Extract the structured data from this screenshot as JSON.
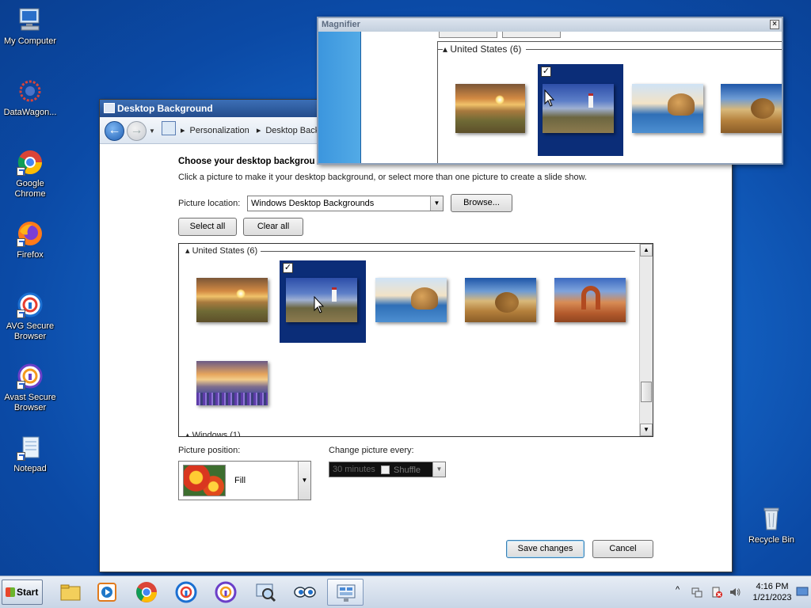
{
  "desktop": {
    "icons": [
      {
        "label": "My Computer"
      },
      {
        "label": "DataWagon..."
      },
      {
        "label": "Google Chrome"
      },
      {
        "label": "Firefox"
      },
      {
        "label": "AVG Secure Browser"
      },
      {
        "label": "Avast Secure Browser"
      },
      {
        "label": "Notepad"
      },
      {
        "label": "Recycle Bin"
      }
    ]
  },
  "window": {
    "title": "Desktop Background",
    "breadcrumb": [
      "Personalization",
      "Desktop Backgro"
    ]
  },
  "content": {
    "heading": "Choose your desktop backgrou",
    "subheading": "Click a picture to make it your desktop background, or select more than one picture to create a slide show.",
    "picture_location_label": "Picture location:",
    "picture_location_value": "Windows Desktop Backgrounds",
    "browse_label": "Browse...",
    "select_all_label": "Select all",
    "clear_all_label": "Clear all",
    "group_united_states": "United States (6)",
    "group_windows": "Windows (1)",
    "thumbnails": [
      {
        "name": "Sunset meadow",
        "selected": false
      },
      {
        "name": "Lighthouse",
        "selected": true
      },
      {
        "name": "Rock on lake",
        "selected": false
      },
      {
        "name": "Hay bale",
        "selected": false
      },
      {
        "name": "Delicate arch",
        "selected": false
      },
      {
        "name": "Flower field lake",
        "selected": false
      }
    ],
    "picture_position_label": "Picture position:",
    "picture_position_value": "Fill",
    "change_every_label": "Change picture every:",
    "change_every_value": "30 minutes",
    "shuffle_label": "Shuffle",
    "save_label": "Save changes",
    "cancel_label": "Cancel"
  },
  "magnifier": {
    "title": "Magnifier",
    "close": "×",
    "group": "United States (6)"
  },
  "taskbar": {
    "start_label": "Start",
    "time": "4:16 PM",
    "date": "1/21/2023",
    "show_hidden": "^"
  }
}
